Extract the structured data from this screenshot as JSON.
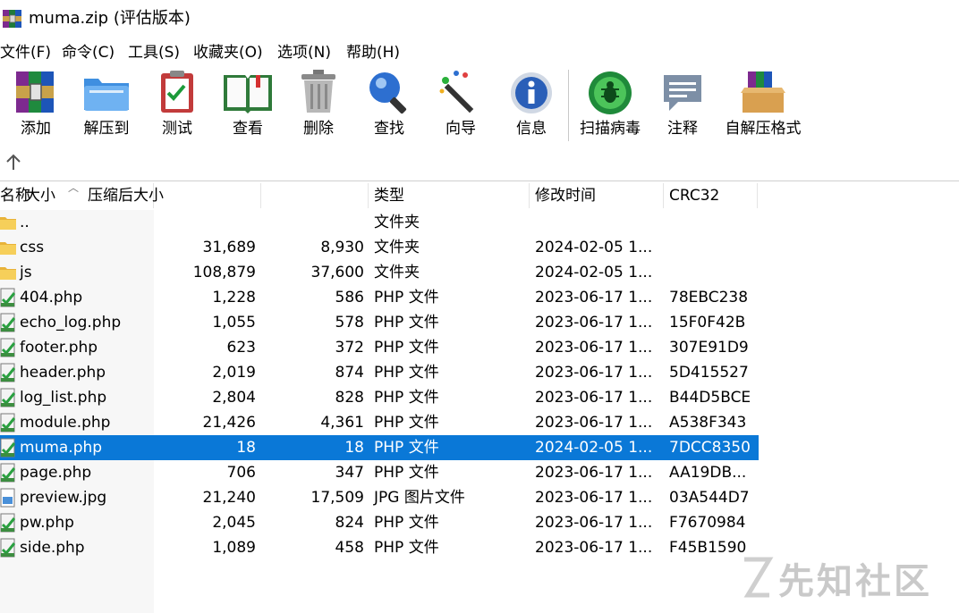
{
  "window": {
    "title": "muma.zip (评估版本)"
  },
  "menu": [
    "文件(F)",
    "命令(C)",
    "工具(S)",
    "收藏夹(O)",
    "选项(N)",
    "帮助(H)"
  ],
  "toolbar": {
    "add": "添加",
    "extract": "解压到",
    "test": "测试",
    "view": "查看",
    "delete": "删除",
    "find": "查找",
    "wizard": "向导",
    "info": "信息",
    "scan": "扫描病毒",
    "comment": "注释",
    "sfx": "自解压格式"
  },
  "columns": {
    "name": "名称",
    "size": "大小",
    "packed": "压缩后大小",
    "type": "类型",
    "modified": "修改时间",
    "crc": "CRC32"
  },
  "rows": [
    {
      "name": "..",
      "size": "",
      "packed": "",
      "type": "文件夹",
      "modified": "",
      "crc": "",
      "icon": "folder-icon"
    },
    {
      "name": "css",
      "size": "31,689",
      "packed": "8,930",
      "type": "文件夹",
      "modified": "2024-02-05 1...",
      "crc": "",
      "icon": "folder-icon"
    },
    {
      "name": "js",
      "size": "108,879",
      "packed": "37,600",
      "type": "文件夹",
      "modified": "2024-02-05 1...",
      "crc": "",
      "icon": "folder-icon"
    },
    {
      "name": "404.php",
      "size": "1,228",
      "packed": "586",
      "type": "PHP 文件",
      "modified": "2023-06-17 1...",
      "crc": "78EBC238",
      "icon": "php-file-icon"
    },
    {
      "name": "echo_log.php",
      "size": "1,055",
      "packed": "578",
      "type": "PHP 文件",
      "modified": "2023-06-17 1...",
      "crc": "15F0F42B",
      "icon": "php-file-icon"
    },
    {
      "name": "footer.php",
      "size": "623",
      "packed": "372",
      "type": "PHP 文件",
      "modified": "2023-06-17 1...",
      "crc": "307E91D9",
      "icon": "php-file-icon"
    },
    {
      "name": "header.php",
      "size": "2,019",
      "packed": "874",
      "type": "PHP 文件",
      "modified": "2023-06-17 1...",
      "crc": "5D415527",
      "icon": "php-file-icon"
    },
    {
      "name": "log_list.php",
      "size": "2,804",
      "packed": "828",
      "type": "PHP 文件",
      "modified": "2023-06-17 1...",
      "crc": "B44D5BCE",
      "icon": "php-file-icon"
    },
    {
      "name": "module.php",
      "size": "21,426",
      "packed": "4,361",
      "type": "PHP 文件",
      "modified": "2023-06-17 1...",
      "crc": "A538F343",
      "icon": "php-file-icon"
    },
    {
      "name": "muma.php",
      "size": "18",
      "packed": "18",
      "type": "PHP 文件",
      "modified": "2024-02-05 1...",
      "crc": "7DCC8350",
      "icon": "php-file-icon",
      "selected": true
    },
    {
      "name": "page.php",
      "size": "706",
      "packed": "347",
      "type": "PHP 文件",
      "modified": "2023-06-17 1...",
      "crc": "AA19DB...",
      "icon": "php-file-icon"
    },
    {
      "name": "preview.jpg",
      "size": "21,240",
      "packed": "17,509",
      "type": "JPG 图片文件",
      "modified": "2023-06-17 1...",
      "crc": "03A544D7",
      "icon": "image-file-icon"
    },
    {
      "name": "pw.php",
      "size": "2,045",
      "packed": "824",
      "type": "PHP 文件",
      "modified": "2023-06-17 1...",
      "crc": "F7670984",
      "icon": "php-file-icon"
    },
    {
      "name": "side.php",
      "size": "1,089",
      "packed": "458",
      "type": "PHP 文件",
      "modified": "2023-06-17 1...",
      "crc": "F45B1590",
      "icon": "php-file-icon"
    }
  ],
  "watermark": "先知社区",
  "colors": {
    "selection": "#0a78d7"
  }
}
